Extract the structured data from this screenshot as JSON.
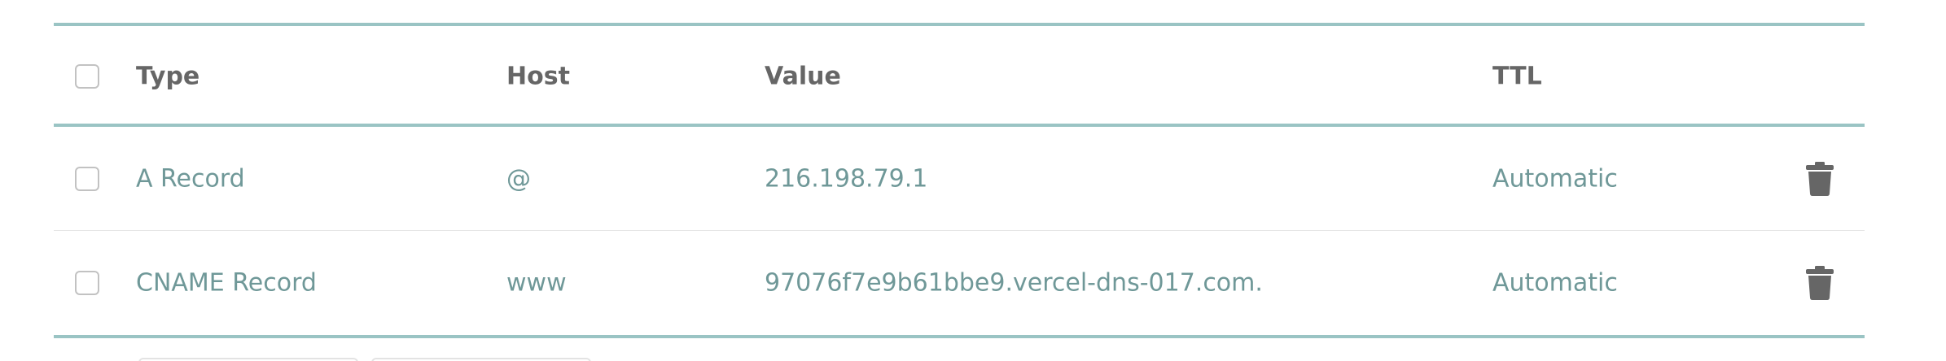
{
  "table": {
    "headers": {
      "type": "Type",
      "host": "Host",
      "value": "Value",
      "ttl": "TTL"
    },
    "rows": [
      {
        "type": "A Record",
        "host": "@",
        "value": "216.198.79.1",
        "ttl": "Automatic",
        "action_icon": "trash-icon"
      },
      {
        "type": "CNAME Record",
        "host": "www",
        "value": "97076f7e9b61bbe9.vercel-dns-017.com.",
        "ttl": "Automatic",
        "action_icon": "trash-icon"
      }
    ]
  },
  "colors": {
    "rule": "#9ac4c4",
    "header_text": "#666666",
    "value_text": "#6f9898",
    "icon": "#666666"
  }
}
